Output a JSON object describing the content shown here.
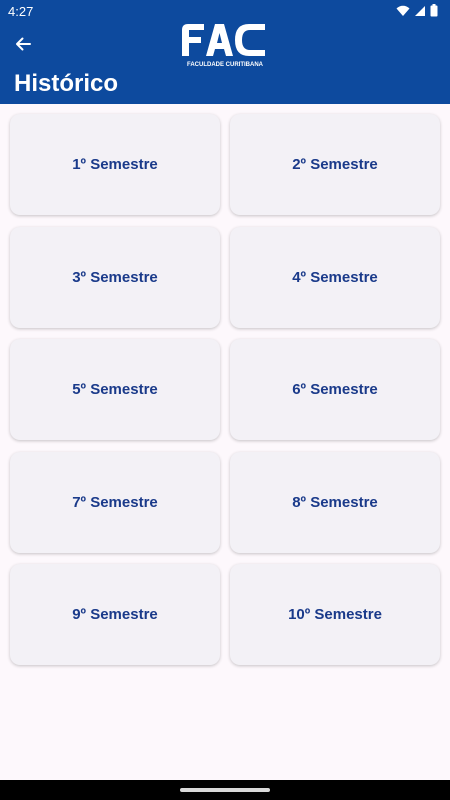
{
  "status_bar": {
    "time": "4:27",
    "icons": [
      "wifi-icon",
      "signal-icon",
      "battery-icon"
    ]
  },
  "header": {
    "back_icon": "arrow-left-icon",
    "logo_text": "FAC",
    "logo_subtitle": "FACULDADE CURITIBANA",
    "title": "Histórico"
  },
  "colors": {
    "header_bg": "#0d4a9e",
    "card_bg": "#f3f1f6",
    "card_text": "#1a3a8a",
    "page_bg": "#fdf8fc"
  },
  "semesters": [
    {
      "label": "1º Semestre"
    },
    {
      "label": "2º Semestre"
    },
    {
      "label": "3º Semestre"
    },
    {
      "label": "4º Semestre"
    },
    {
      "label": "5º Semestre"
    },
    {
      "label": "6º Semestre"
    },
    {
      "label": "7º Semestre"
    },
    {
      "label": "8º Semestre"
    },
    {
      "label": "9º Semestre"
    },
    {
      "label": "10º Semestre"
    }
  ]
}
